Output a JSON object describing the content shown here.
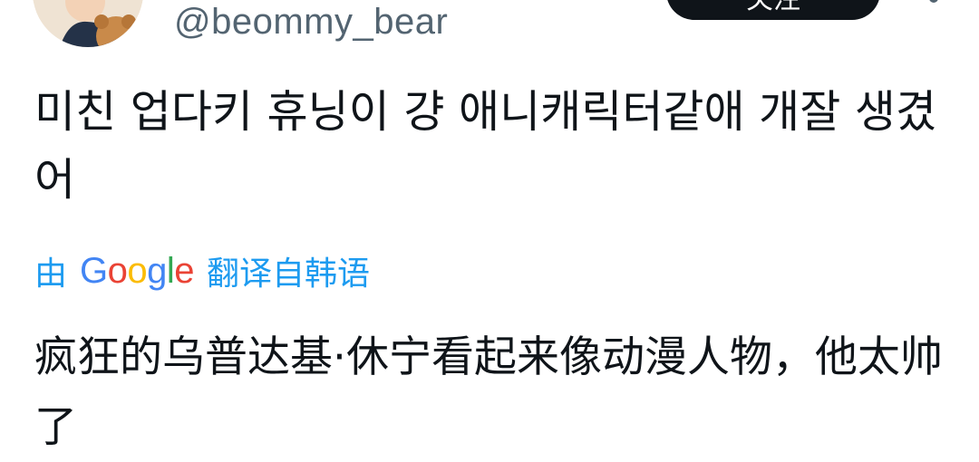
{
  "tweet": {
    "handle": "@beommy_bear",
    "follow_label": "关注",
    "text": "미친 업다키 휴닝이 걍 애니캐릭터같애 개잘 생겼어",
    "translation": {
      "prefix": "由",
      "provider_letters": [
        "G",
        "o",
        "o",
        "g",
        "l",
        "e"
      ],
      "provider_colors": [
        "#4285F4",
        "#EA4335",
        "#FBBC05",
        "#4285F4",
        "#34A853",
        "#EA4335"
      ],
      "suffix": "翻译自韩语",
      "text": "疯狂的乌普达基·休宁看起来像动漫人物，他太帅了"
    }
  },
  "colors": {
    "link": "#1d9bf0",
    "handle": "#536471",
    "text": "#0f1419"
  }
}
